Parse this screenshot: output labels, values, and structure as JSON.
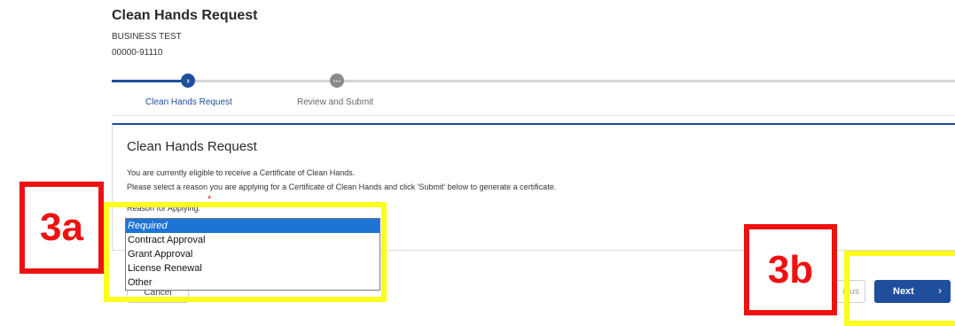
{
  "header": {
    "title": "Clean Hands Request",
    "business_name": "BUSINESS TEST",
    "account_id": "00000-91110"
  },
  "stepper": {
    "steps": [
      {
        "label": "Clean Hands Request",
        "icon": "chevron-right-icon",
        "state": "current"
      },
      {
        "label": "Review and Submit",
        "icon": "ellipsis-icon",
        "state": "pending"
      }
    ],
    "accent_color": "#1f4e9c"
  },
  "card": {
    "title": "Clean Hands Request",
    "line1": "You are currently eligible to receive a Certificate of Clean Hands.",
    "line2": "Please select a reason you are applying for a Certificate of Clean Hands and click 'Submit' below to generate a certificate.",
    "required_mark": "*",
    "field_label": "Reason for Applying:"
  },
  "dropdown": {
    "selected": "Required",
    "options": [
      "Required",
      "Contract Approval",
      "Grant Approval",
      "License Renewal",
      "Other"
    ]
  },
  "footer": {
    "cancel_label": "Cancel",
    "previous_label": "ious",
    "next_label": "Next",
    "next_icon": "chevron-right-icon"
  },
  "annotations": {
    "tag_a": "3a",
    "tag_b": "3b",
    "highlight_color": "#ffff1e",
    "tag_color": "#ee1111"
  }
}
